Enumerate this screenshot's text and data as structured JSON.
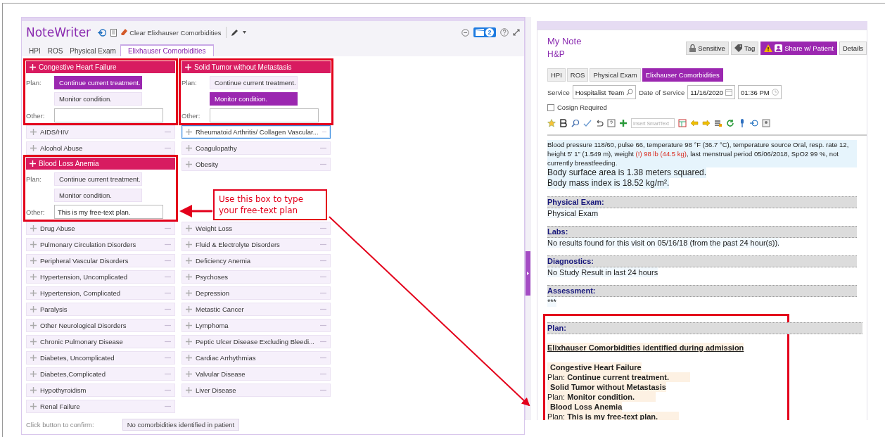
{
  "notewriter": {
    "title": "NoteWriter",
    "clear_button": "Clear Elixhauser Comorbidities",
    "badge": "2",
    "tabs": [
      {
        "label": "HPI",
        "selected": false
      },
      {
        "label": "ROS",
        "selected": false
      },
      {
        "label": "Physical Exam",
        "selected": false
      },
      {
        "label": "Elixhauser Comorbidities",
        "selected": true
      }
    ],
    "items": [
      {
        "kind": "expanded",
        "name": "Congestive Heart Failure",
        "highlighted": true,
        "plan_label": "Plan:",
        "options": [
          {
            "label": "Continue current treatment.",
            "selected": true
          },
          {
            "label": "Monitor condition.",
            "selected": false
          }
        ],
        "other_label": "Other:"
      },
      {
        "kind": "expanded",
        "name": "Solid Tumor without Metastasis",
        "highlighted": true,
        "plan_label": "Plan:",
        "options": [
          {
            "label": "Continue current treatment.",
            "selected": false
          },
          {
            "label": "Monitor condition.",
            "selected": true
          }
        ],
        "other_label": "Other:"
      },
      {
        "kind": "collapsed",
        "name": "AIDS/HIV",
        "highlighted": false,
        "focused": false
      },
      {
        "kind": "collapsed",
        "name": "Rheumatoid Arthritis/ Collagen Vascular...",
        "highlighted": false,
        "focused": true
      },
      {
        "kind": "collapsed",
        "name": "Alcohol Abuse",
        "highlighted": false,
        "focused": false
      },
      {
        "kind": "collapsed",
        "name": "Coagulopathy",
        "highlighted": false,
        "focused": false
      },
      {
        "kind": "expanded",
        "name": "Blood Loss Anemia",
        "highlighted": true,
        "plan_label": "Plan:",
        "options": [
          {
            "label": "Continue current treatment.",
            "selected": false
          },
          {
            "label": "Monitor condition.",
            "selected": false
          }
        ],
        "other_label": "Other:",
        "other_value": "This is my free-text plan."
      },
      {
        "kind": "collapsed",
        "name": "Obesity",
        "highlighted": false,
        "focused": false
      },
      {
        "kind": "collapsed",
        "name": "Drug Abuse",
        "highlighted": false,
        "focused": false
      },
      {
        "kind": "collapsed",
        "name": "Weight Loss",
        "highlighted": false,
        "focused": false
      },
      {
        "kind": "collapsed",
        "name": "Pulmonary Circulation Disorders",
        "highlighted": false,
        "focused": false
      },
      {
        "kind": "collapsed",
        "name": "Fluid & Electrolyte Disorders",
        "highlighted": false,
        "focused": false
      },
      {
        "kind": "collapsed",
        "name": "Peripheral Vascular Disorders",
        "highlighted": false,
        "focused": false
      },
      {
        "kind": "collapsed",
        "name": "Deficiency Anemia",
        "highlighted": false,
        "focused": false
      },
      {
        "kind": "collapsed",
        "name": "Hypertension, Uncomplicated",
        "highlighted": false,
        "focused": false
      },
      {
        "kind": "collapsed",
        "name": "Psychoses",
        "highlighted": false,
        "focused": false
      },
      {
        "kind": "collapsed",
        "name": "Hypertension, Complicated",
        "highlighted": false,
        "focused": false
      },
      {
        "kind": "collapsed",
        "name": "Depression",
        "highlighted": false,
        "focused": false
      },
      {
        "kind": "collapsed",
        "name": "Paralysis",
        "highlighted": false,
        "focused": false
      },
      {
        "kind": "collapsed",
        "name": "Metastic Cancer",
        "highlighted": false,
        "focused": false
      },
      {
        "kind": "collapsed",
        "name": "Other Neurological Disorders",
        "highlighted": false,
        "focused": false
      },
      {
        "kind": "collapsed",
        "name": "Lymphoma",
        "highlighted": false,
        "focused": false
      },
      {
        "kind": "collapsed",
        "name": "Chronic Pulmonary Disease",
        "highlighted": false,
        "focused": false
      },
      {
        "kind": "collapsed",
        "name": "Peptic Ulcer Disease Excluding Bleedi...",
        "highlighted": false,
        "focused": false
      },
      {
        "kind": "collapsed",
        "name": "Diabetes, Uncomplicated",
        "highlighted": false,
        "focused": false
      },
      {
        "kind": "collapsed",
        "name": "Cardiac Arrhythmias",
        "highlighted": false,
        "focused": false
      },
      {
        "kind": "collapsed",
        "name": "Diabetes,Complicated",
        "highlighted": false,
        "focused": false
      },
      {
        "kind": "collapsed",
        "name": "Valvular Disease",
        "highlighted": false,
        "focused": false
      },
      {
        "kind": "collapsed",
        "name": "Hypothyroidism",
        "highlighted": false,
        "focused": false
      },
      {
        "kind": "collapsed",
        "name": "Liver Disease",
        "highlighted": false,
        "focused": false
      },
      {
        "kind": "collapsed",
        "name": "Renal Failure",
        "highlighted": false,
        "focused": false
      }
    ],
    "confirm_label": "Click button to confirm:",
    "confirm_button": "No comorbidities identified in patient"
  },
  "callout": {
    "text": "Use this box to type your free-text plan"
  },
  "note": {
    "title": "My Note",
    "subtitle": "H&P",
    "buttons": [
      {
        "label": "Sensitive",
        "kind": "lock"
      },
      {
        "label": "Tag",
        "kind": "tag"
      },
      {
        "label": "Share w/ Patient",
        "kind": "share"
      },
      {
        "label": "Details",
        "kind": "plain"
      }
    ],
    "tabs": [
      {
        "label": "HPI",
        "selected": false
      },
      {
        "label": "ROS",
        "selected": false
      },
      {
        "label": "Physical Exam",
        "selected": false
      },
      {
        "label": "Elixhauser Comorbidities",
        "selected": true
      }
    ],
    "service_label": "Service",
    "service_value": "Hospitalist Team",
    "date_label": "Date of Service",
    "date_value": "11/16/2020",
    "time_value": "01:36 PM",
    "cosign": {
      "label": "Cosign Required",
      "checked": false
    },
    "smarttext_placeholder": "Insert SmartText",
    "vitals": [
      {
        "text": "Blood pressure 118/60, pulse 66, temperature 98 °F (36.7 °C), temperature source Oral, resp. rate 12, height 5' 1\" (1.549 m), weight ",
        "abnormal": false
      },
      {
        "text": "(!) 98 lb (44.5 kg)",
        "abnormal": true
      },
      {
        "text": ", last menstrual period 05/06/2018, SpO2 99 %, not currently breastfeeding.",
        "abnormal": false
      }
    ],
    "bsa": "Body surface area is 1.38 meters squared.",
    "bmi": "Body mass index is 18.52 kg/m².",
    "sections": [
      {
        "heading": "Physical Exam:",
        "highlighted": false,
        "lines": [
          {
            "kind": "text",
            "text": "Physical Exam"
          }
        ]
      },
      {
        "heading": "Labs:",
        "highlighted": false,
        "lines": [
          {
            "kind": "text",
            "text": "No results found for this visit on 05/16/18 (from the past 24 hour(s))."
          }
        ]
      },
      {
        "heading": "Diagnostics:",
        "highlighted": false,
        "lines": [
          {
            "kind": "text",
            "text": "No Study Result in last 24 hours"
          }
        ]
      },
      {
        "heading": "Assessment:",
        "highlighted": false,
        "lines": [
          {
            "kind": "text",
            "text": "***"
          }
        ]
      },
      {
        "heading": "Plan:",
        "highlighted": true,
        "lines": [
          {
            "kind": "title",
            "text": "Elixhauser Comorbidities identified during admission"
          },
          {
            "kind": "problem",
            "text": "Congestive Heart Failure"
          },
          {
            "kind": "plan",
            "text": "Plan: **Continue current treatment.**"
          },
          {
            "kind": "problem",
            "text": "Solid Tumor without Metastasis"
          },
          {
            "kind": "plan",
            "text": "Plan: **Monitor condition.**"
          },
          {
            "kind": "problem",
            "text": "Blood Loss Anemia"
          },
          {
            "kind": "plan",
            "text": "Plan: **This is my free-text plan.**"
          }
        ]
      }
    ]
  }
}
